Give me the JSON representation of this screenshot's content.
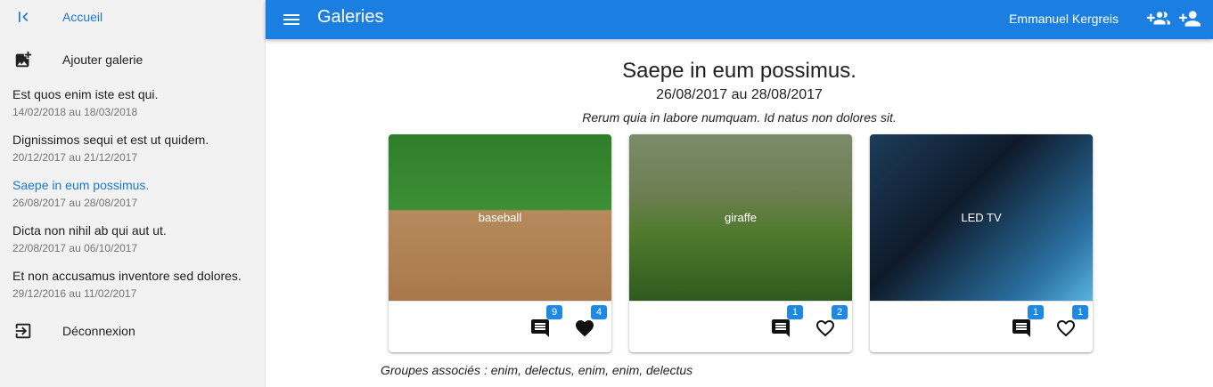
{
  "sidebar": {
    "home_label": "Accueil",
    "add_label": "Ajouter galerie",
    "logout_label": "Déconnexion",
    "galleries": [
      {
        "title": "Est quos enim iste est qui.",
        "dates": "14/02/2018 au 18/03/2018"
      },
      {
        "title": "Dignissimos sequi et est ut quidem.",
        "dates": "20/12/2017 au 21/12/2017"
      },
      {
        "title": "Saepe in eum possimus.",
        "dates": "26/08/2017 au 28/08/2017"
      },
      {
        "title": "Dicta non nihil ab qui aut ut.",
        "dates": "22/08/2017 au 06/10/2017"
      },
      {
        "title": "Et non accusamus inventore sed dolores.",
        "dates": "29/12/2016 au 11/02/2017"
      }
    ]
  },
  "appbar": {
    "title": "Galeries",
    "user_name": "Emmanuel Kergreis"
  },
  "gallery": {
    "title": "Saepe in eum possimus.",
    "dates": "26/08/2017 au 28/08/2017",
    "description": "Rerum quia in labore numquam. Id natus non dolores sit.",
    "groups_label": "Groupes associés : enim, delectus, enim, enim, delectus"
  },
  "photos": [
    {
      "placeholder": "baseball",
      "comments": "9",
      "likes": "4",
      "liked": true
    },
    {
      "placeholder": "giraffe",
      "comments": "1",
      "likes": "2",
      "liked": false
    },
    {
      "placeholder": "LED TV",
      "comments": "1",
      "likes": "1",
      "liked": false
    }
  ],
  "colors": {
    "primary": "#1a7fe0",
    "accent": "#1976d2",
    "badge": "#1e88e5"
  }
}
